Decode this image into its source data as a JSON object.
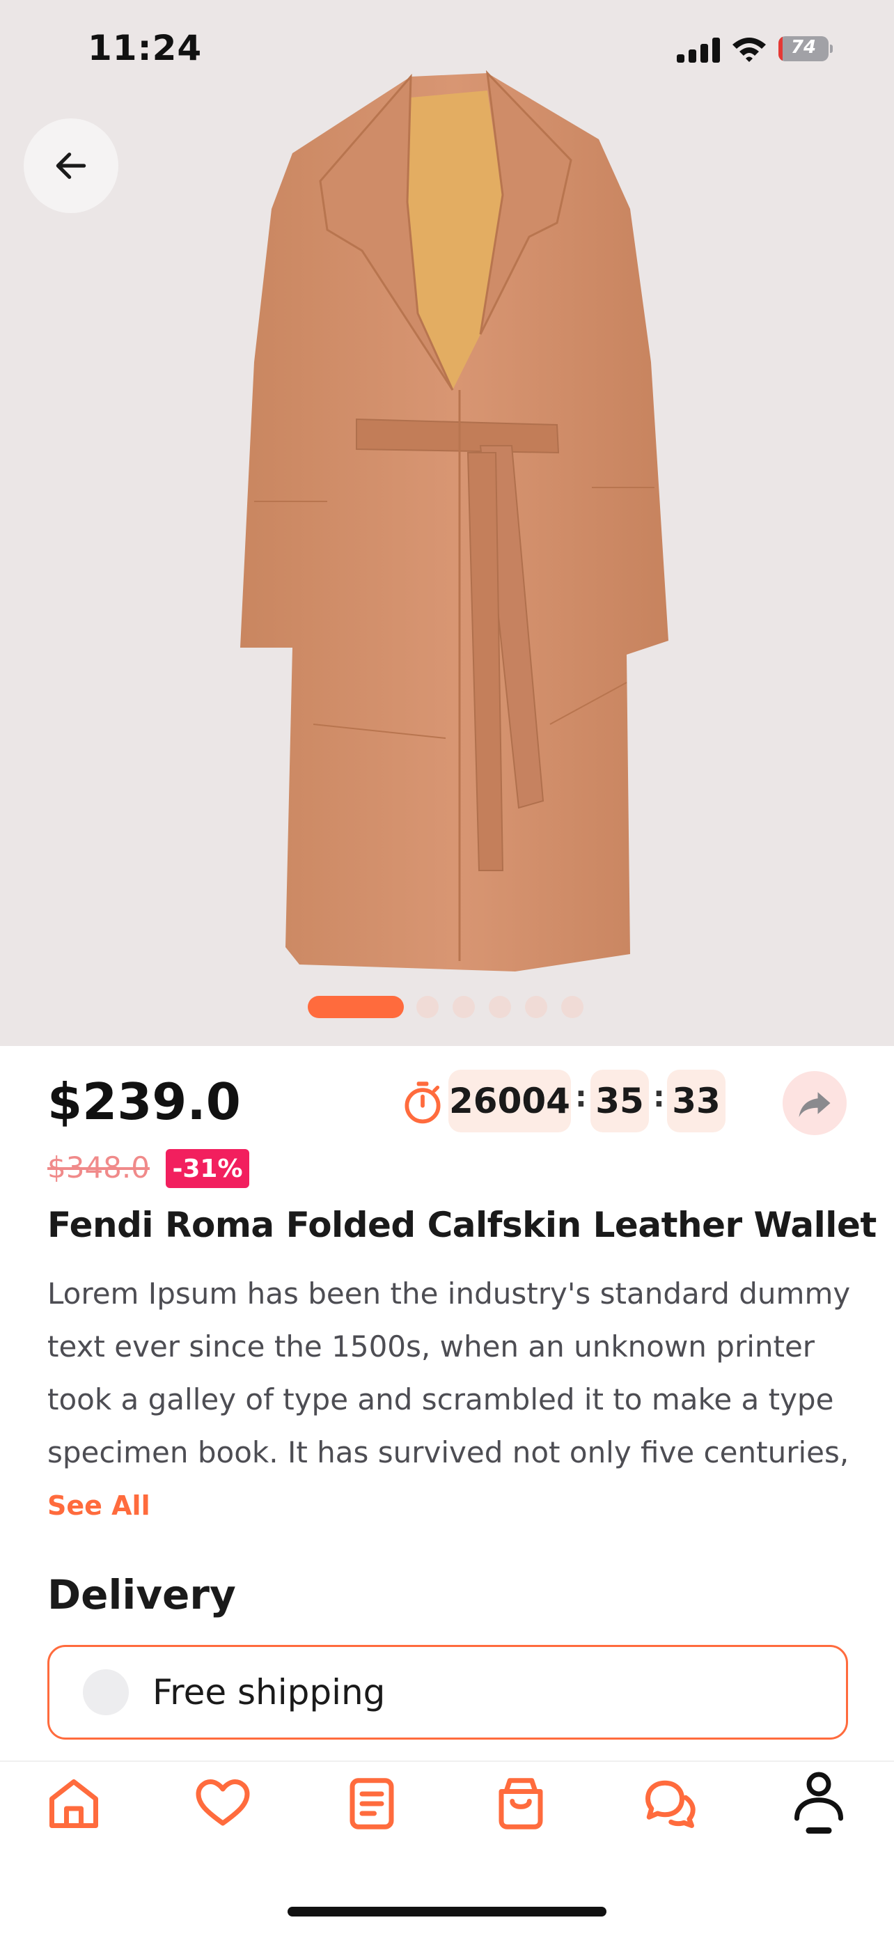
{
  "status_bar": {
    "time": "11:24",
    "battery": "74"
  },
  "product": {
    "price": "$239.0",
    "old_price": "$348.0",
    "discount": "-31%",
    "title": "Fendi Roma Folded Calfskin Leather Wallet",
    "description": "Lorem Ipsum has been the industry's standard dummy text ever since the 1500s, when an unknown printer took a galley of type and scrambled it to make a type specimen book. It has survived not only five centuries,",
    "see_all": "See All",
    "image_count": 6,
    "active_image": 1
  },
  "timer": {
    "hours": "26004",
    "minutes": "35",
    "seconds": "33",
    "separator": ":"
  },
  "delivery": {
    "title": "Delivery",
    "option": "Free shipping"
  },
  "colors": {
    "accent": "#ff6b3d",
    "discount": "#f21f5e",
    "old_price": "#f08a8a",
    "timer_bg": "#fdece5"
  },
  "nav": {
    "items": [
      {
        "icon": "home-icon"
      },
      {
        "icon": "heart-icon"
      },
      {
        "icon": "orders-icon"
      },
      {
        "icon": "cart-icon"
      },
      {
        "icon": "chat-icon"
      },
      {
        "icon": "profile-icon"
      }
    ]
  }
}
